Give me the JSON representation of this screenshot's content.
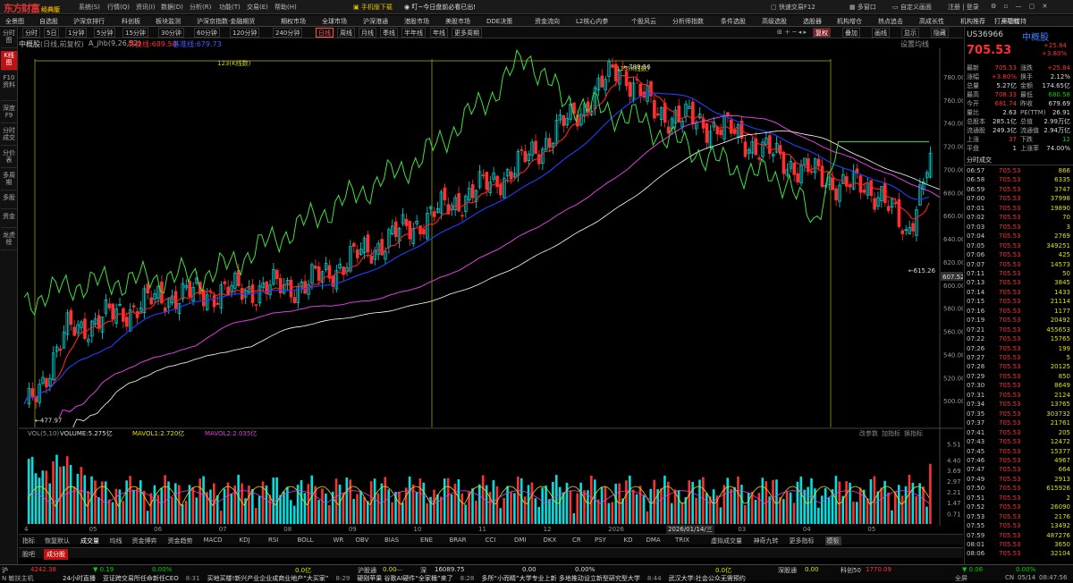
{
  "titlebar": {
    "app_name": "东方财富",
    "edition": "经典版",
    "menu": [
      "系统(S)",
      "行情(Q)",
      "资讯(I)",
      "数据(D)",
      "分析(R)",
      "功能(T)",
      "交易(E)",
      "帮助(H)"
    ],
    "mobile_download": "手机版下载",
    "notice": "叮~今日盘前必看已出!",
    "quick_trade": "快速交易F12",
    "multi_window": "多窗口",
    "custom_layout": "自定义画面",
    "login": "注册 | 登录"
  },
  "menubar": [
    "全景图",
    "自选股",
    "沪深京排行",
    "科创板",
    "板块监测",
    "沪深京指数·金融期货",
    "期权市场",
    "全球市场",
    "沪深港通",
    "港股市场",
    "美股市场",
    "DDE决策",
    "资金流向",
    "L2核心内参",
    "个股风云",
    "分析师指数",
    "条件选股",
    "高级选股",
    "选股器",
    "机构增仓",
    "热点追击",
    "高成长性",
    "机构推荐",
    "高管增持",
    "打开导航"
  ],
  "sidebar": [
    "分时图",
    "K线图",
    "F10资料",
    "深度F9",
    "分时成交",
    "分价表",
    "多周期",
    "多股",
    "资金",
    "龙虎榜"
  ],
  "periodbar": {
    "buttons": [
      "分时",
      "5日",
      "1分钟",
      "5分钟",
      "15分钟",
      "30分钟",
      "60分钟",
      "120分钟",
      "240分钟",
      "日线",
      "周线",
      "月线",
      "季线",
      "半年线",
      "年线",
      "更多周期"
    ],
    "selected": "日线",
    "right_buttons": [
      "复权",
      "叠加",
      "画线",
      "显示",
      "隐藏"
    ]
  },
  "infobar": {
    "stock": "中概股",
    "mode": "(日线,前复权)",
    "indicator": "A_jhb(9,26,52)",
    "conv_line": "转换线:689.50",
    "base_line": "基准线:679.73",
    "settings": "设置均线"
  },
  "chart_data": [
    {
      "type": "candlestick",
      "title": "中概股 (日线,前复权)",
      "ylim": [
        480,
        800
      ],
      "y_ticks": [
        500,
        520,
        540,
        560,
        580,
        600,
        620,
        640,
        660,
        680,
        700,
        720,
        740,
        760,
        780
      ],
      "x_ticks": [
        "4",
        "05",
        "06",
        "07",
        "08",
        "09",
        "10",
        "11",
        "12",
        "2026",
        "02",
        "03",
        "04",
        "05"
      ],
      "annotations": [
        {
          "text": "789.56",
          "kind": "high"
        },
        {
          "text": "477.97",
          "kind": "low"
        },
        {
          "text": "615.26",
          "kind": "local-low"
        },
        {
          "text": "607.52",
          "kind": "price-marker"
        },
        {
          "text": "123(K线数)",
          "kind": "count-left"
        },
        {
          "text": "123(K线数)",
          "kind": "count-right"
        }
      ],
      "date_marker": "2026/01/14/三",
      "series": [
        {
          "name": "转换线",
          "value": 689.5
        },
        {
          "name": "基准线",
          "value": 679.73
        }
      ],
      "colors": {
        "up": "#00e0e0",
        "down": "#ff3030",
        "conv": "#ff2020",
        "base": "#2040ff",
        "lead_a": "#e040e0",
        "lead_b": "#ffffff",
        "lag": "#40e040"
      }
    },
    {
      "type": "bar",
      "title": "VOL(5,10)",
      "labels": [
        "VOLUME:5.275亿",
        "MAVOL1:2.720亿",
        "MAVOL2:2.035亿"
      ],
      "y_ticks": [
        0.71,
        1.47,
        2.21,
        2.97,
        3.69,
        4.4,
        5.51
      ],
      "right_tools": [
        "改参数",
        "加指标",
        "换指标"
      ]
    }
  ],
  "indicator_tabs": [
    "指标",
    "恢复默认",
    "成交量",
    "均线",
    "资金博弈",
    "资金趋势",
    "MACD",
    "KDJ",
    "RSI",
    "BOLL",
    "WR",
    "OBV",
    "BIAS",
    "ENE",
    "BRAR",
    "CCI",
    "DMI",
    "DKX",
    "CR",
    "PSY",
    "KD",
    "DMA",
    "TRIX",
    "虚拟成交量",
    "神奇九转",
    "更多指标",
    "模板"
  ],
  "bottom_tabs": [
    "股吧",
    "成分股"
  ],
  "rightpanel": {
    "code": "US36966",
    "name": "中概股",
    "price": "705.53",
    "change": "+25.84",
    "change_pct": "+3.80%",
    "stats": [
      [
        "最新",
        "705.53",
        "涨跌",
        "+25.84"
      ],
      [
        "涨幅",
        "+3.80%",
        "换手",
        "2.12%"
      ],
      [
        "总量",
        "5.27亿",
        "金额",
        "174.65亿"
      ],
      [
        "最高",
        "708.33",
        "最低",
        "680.58"
      ],
      [
        "今开",
        "681.74",
        "昨收",
        "679.69"
      ],
      [
        "量比",
        "2.63",
        "PE(TTM)",
        "26.91"
      ],
      [
        "总股本",
        "285.1亿",
        "总值",
        "2.99万亿"
      ],
      [
        "流通股",
        "249.3亿",
        "流通值",
        "2.94万亿"
      ],
      [
        "上涨",
        "37",
        "下跌",
        "12"
      ],
      [
        "平盘",
        "1",
        "上涨率",
        "74.00%"
      ]
    ],
    "ticks_title": "分时成交",
    "ticks": [
      [
        "06:57",
        "705.53",
        "866"
      ],
      [
        "06:58",
        "705.53",
        "6335"
      ],
      [
        "06:59",
        "705.53",
        "3747"
      ],
      [
        "07:00",
        "705.53",
        "37998"
      ],
      [
        "07:01",
        "705.53",
        "19890"
      ],
      [
        "07:02",
        "705.53",
        "70"
      ],
      [
        "07:03",
        "705.53",
        "3"
      ],
      [
        "07:04",
        "705.53",
        "2769"
      ],
      [
        "07:05",
        "705.53",
        "349251"
      ],
      [
        "07:06",
        "705.53",
        "425"
      ],
      [
        "07:07",
        "705.53",
        "14573"
      ],
      [
        "07:11",
        "705.53",
        "50"
      ],
      [
        "07:13",
        "705.53",
        "3845"
      ],
      [
        "07:14",
        "705.53",
        "1433"
      ],
      [
        "07:15",
        "705.53",
        "21114"
      ],
      [
        "07:16",
        "705.53",
        "1177"
      ],
      [
        "07:19",
        "705.53",
        "20492"
      ],
      [
        "07:21",
        "705.53",
        "455653"
      ],
      [
        "07:22",
        "705.53",
        "15765"
      ],
      [
        "07:26",
        "705.53",
        "199"
      ],
      [
        "07:27",
        "705.53",
        "5"
      ],
      [
        "07:28",
        "705.53",
        "20125"
      ],
      [
        "07:29",
        "705.53",
        "850"
      ],
      [
        "07:30",
        "705.53",
        "8649"
      ],
      [
        "07:31",
        "705.53",
        "2124"
      ],
      [
        "07:34",
        "705.53",
        "13765"
      ],
      [
        "07:35",
        "705.53",
        "303732"
      ],
      [
        "07:37",
        "705.53",
        "21761"
      ],
      [
        "07:41",
        "705.53",
        "205"
      ],
      [
        "07:43",
        "705.53",
        "12472"
      ],
      [
        "07:45",
        "705.53",
        "15377"
      ],
      [
        "07:46",
        "705.53",
        "4967"
      ],
      [
        "07:47",
        "705.53",
        "664"
      ],
      [
        "07:49",
        "705.53",
        "2913"
      ],
      [
        "07:50",
        "705.53",
        "615926"
      ],
      [
        "07:51",
        "705.53",
        "2"
      ],
      [
        "07:52",
        "705.53",
        "26090"
      ],
      [
        "07:53",
        "705.53",
        "2176"
      ],
      [
        "07:55",
        "705.53",
        "13492"
      ],
      [
        "07:59",
        "705.53",
        "487276"
      ],
      [
        "08:01",
        "705.53",
        "3650"
      ],
      [
        "08:06",
        "705.53",
        "32104"
      ]
    ]
  },
  "statusbar": {
    "row1": [
      {
        "label": "沪",
        "value": "4242.38",
        "chg": "▼ 0.19",
        "pct": "0.00%",
        "amt": "0.0亿"
      },
      {
        "label": "沪股通",
        "value": "0.00",
        "extra": "—"
      },
      {
        "label": "深",
        "value": "16089.75",
        "chg": "0.00",
        "pct": "0.00%",
        "amt": "0.0亿"
      },
      {
        "label": "深股通",
        "value": "0.00"
      },
      {
        "label": "科创50",
        "value": "1770.09",
        "chg": "▼ 0.06",
        "pct": "0.00%"
      }
    ],
    "row2_left": "N 敏扶主机",
    "news": [
      "24小时直播",
      "亚证跨交易所任命新任CEO",
      "8:31",
      "买地买楼!新兴产业企业成商业地产“大买家”",
      "8:29",
      "硬刚苹果 谷歌AI硬件“全家桶”来了",
      "8:28",
      "多所“小而精”大学专业上新 多地推动设立新型研究型大学",
      "8:44",
      "武汉大学:社会公众无需预约"
    ],
    "right": [
      "全屏",
      "CN",
      "05/14",
      "08:47:56"
    ]
  }
}
